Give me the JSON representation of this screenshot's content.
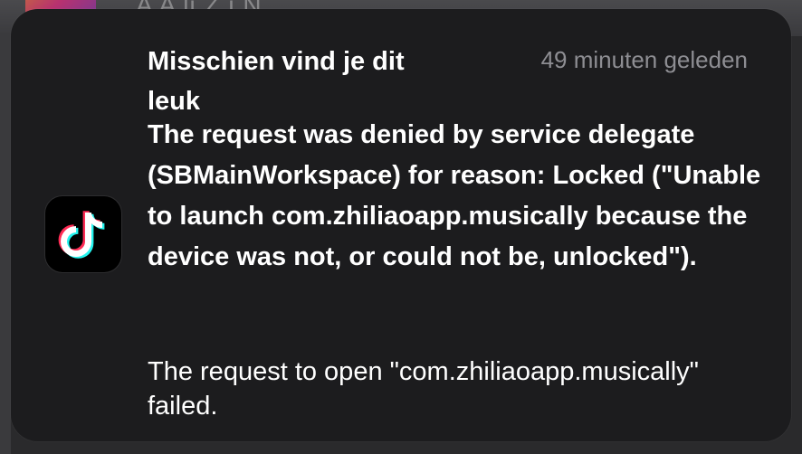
{
  "background": {
    "partial_text": "A           A    li     Z  i       N"
  },
  "notification": {
    "app_icon": "tiktok-icon",
    "title": "Misschien vind je dit leuk",
    "timestamp": "49 minuten geleden",
    "message": "The request was denied by service delegate (SBMainWorkspace) for reason: Locked (\"Unable to launch com.zhiliaoapp.musically because the device was not, or could not be, unlocked\").",
    "detail": "The request to open \"com.zhiliaoapp.musically\" failed."
  },
  "colors": {
    "card_background": "#1c1c1e",
    "primary_text": "#ffffff",
    "secondary_text": "#8e8e93",
    "tiktok_cyan": "#25f4ee",
    "tiktok_red": "#fe2c55"
  }
}
